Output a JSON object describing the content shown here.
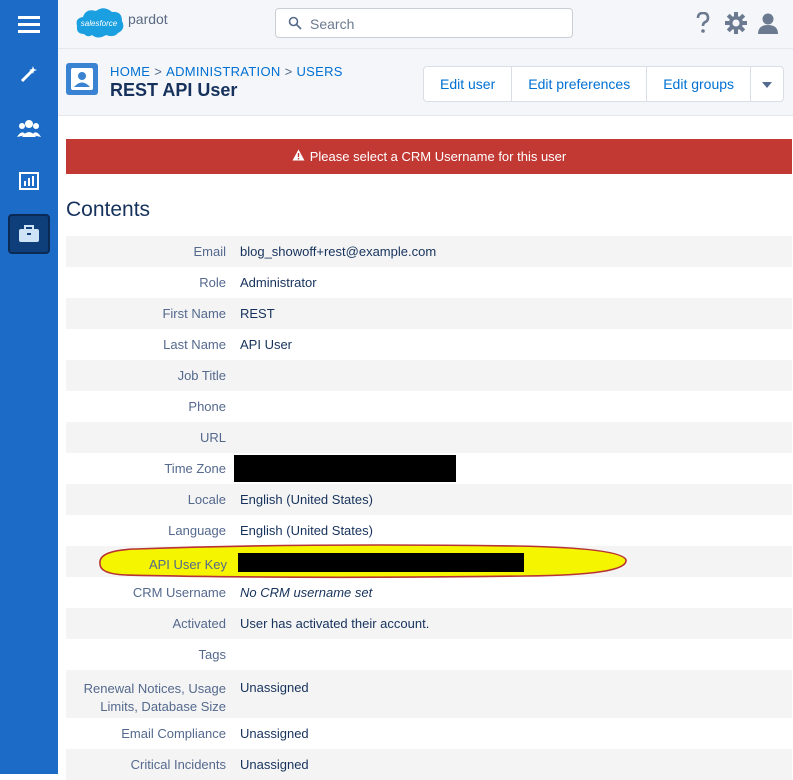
{
  "brand": {
    "logo_word": "salesforce",
    "product": "pardot"
  },
  "search": {
    "placeholder": "Search"
  },
  "breadcrumb": {
    "home": "HOME",
    "sep": ">",
    "admin": "ADMINISTRATION",
    "users": "USERS"
  },
  "page": {
    "title": "REST API User"
  },
  "actions": {
    "edit_user": "Edit user",
    "edit_preferences": "Edit preferences",
    "edit_groups": "Edit groups"
  },
  "alert": {
    "message": "Please select a CRM Username for this user",
    "color": "#c23934"
  },
  "contents": {
    "title": "Contents",
    "rows": [
      {
        "label": "Email",
        "value": "blog_showoff+rest@example.com"
      },
      {
        "label": "Role",
        "value": "Administrator"
      },
      {
        "label": "First Name",
        "value": "REST"
      },
      {
        "label": "Last Name",
        "value": "API User"
      },
      {
        "label": "Job Title",
        "value": ""
      },
      {
        "label": "Phone",
        "value": ""
      },
      {
        "label": "URL",
        "value": ""
      },
      {
        "label": "Time Zone",
        "value": ""
      },
      {
        "label": "Locale",
        "value": "English (United States)"
      },
      {
        "label": "Language",
        "value": "English (United States)"
      },
      {
        "label": "API User Key",
        "value": ""
      },
      {
        "label": "CRM Username",
        "value": "No CRM username set"
      },
      {
        "label": "Activated",
        "value": "User has activated their account."
      },
      {
        "label": "Tags",
        "value": ""
      },
      {
        "label": "Renewal Notices, Usage Limits, Database Size",
        "value": "Unassigned"
      },
      {
        "label": "Email Compliance",
        "value": "Unassigned"
      },
      {
        "label": "Critical Incidents",
        "value": "Unassigned"
      }
    ]
  },
  "colors": {
    "nav": "#1b6bc7",
    "link": "#0070d2",
    "highlight": "#f5f500"
  },
  "icons": [
    "menu-icon",
    "wand-icon",
    "people-icon",
    "chart-icon",
    "briefcase-icon",
    "search-icon",
    "help-icon",
    "gear-icon",
    "user-icon",
    "avatar-icon",
    "warning-icon",
    "chevron-down-icon"
  ]
}
